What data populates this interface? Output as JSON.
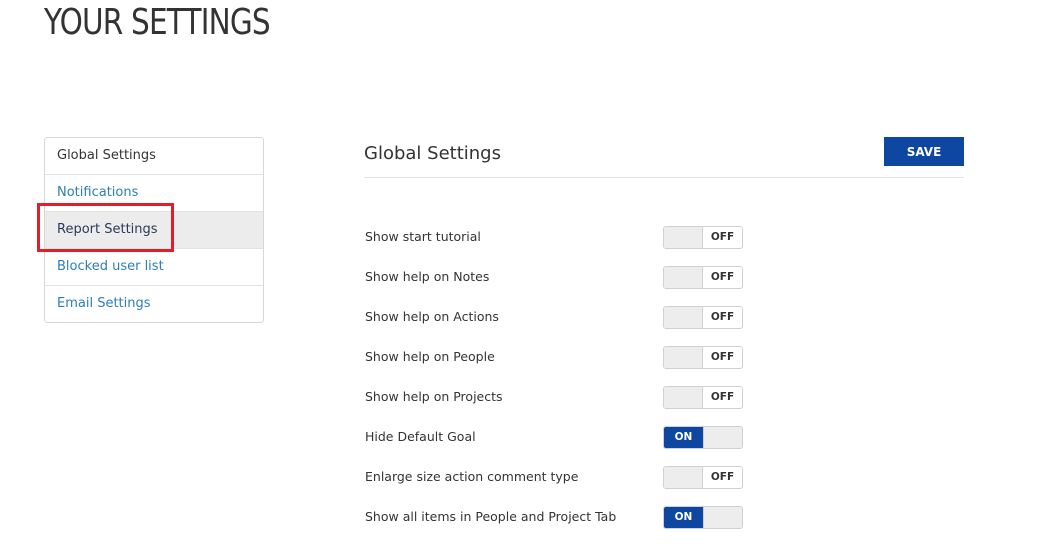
{
  "page": {
    "title": "YOUR SETTINGS"
  },
  "sidebar": {
    "items": [
      {
        "label": "Global Settings"
      },
      {
        "label": "Notifications"
      },
      {
        "label": "Report Settings"
      },
      {
        "label": "Blocked user list"
      },
      {
        "label": "Email Settings"
      }
    ],
    "active_index": 2
  },
  "main": {
    "section_title": "Global Settings",
    "save_label": "SAVE",
    "settings": [
      {
        "label": "Show start tutorial",
        "state": "OFF"
      },
      {
        "label": "Show help on Notes",
        "state": "OFF"
      },
      {
        "label": "Show help on Actions",
        "state": "OFF"
      },
      {
        "label": "Show help on People",
        "state": "OFF"
      },
      {
        "label": "Show help on Projects",
        "state": "OFF"
      },
      {
        "label": "Hide Default Goal",
        "state": "ON"
      },
      {
        "label": "Enlarge size action comment type",
        "state": "OFF"
      },
      {
        "label": "Show all items in People and Project Tab",
        "state": "ON"
      }
    ]
  },
  "colors": {
    "accent": "#0d47a1",
    "link": "#2a7fb8",
    "highlight": "#e01f2a"
  }
}
